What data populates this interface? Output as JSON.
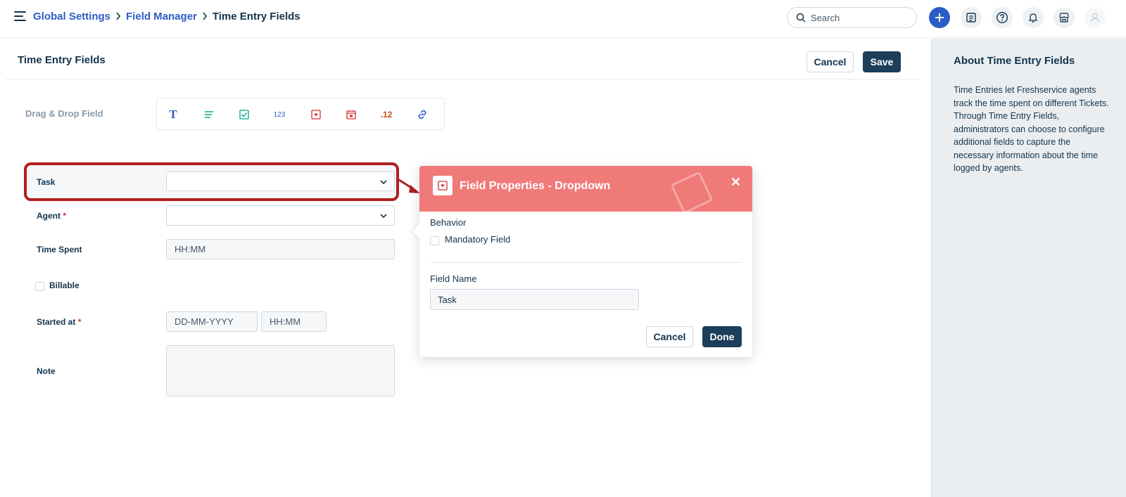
{
  "breadcrumb": {
    "items": [
      "Global Settings",
      "Field Manager"
    ],
    "current": "Time Entry Fields"
  },
  "search": {
    "placeholder": "Search"
  },
  "topbar_icons": [
    "plus-icon",
    "catalog-icon",
    "help-icon",
    "bell-icon",
    "store-icon",
    "user-avatar-icon"
  ],
  "page": {
    "title": "Time Entry Fields",
    "cancel_label": "Cancel",
    "save_label": "Save"
  },
  "palette": {
    "label": "Drag & Drop Field",
    "items": [
      {
        "icon": "text-field-icon",
        "glyph": "T",
        "color": "#2c5cc5"
      },
      {
        "icon": "paragraph-field-icon",
        "glyph": "",
        "color": "#00a886"
      },
      {
        "icon": "checkbox-field-icon",
        "glyph": "",
        "color": "#00a886"
      },
      {
        "icon": "number-field-icon",
        "glyph": "123",
        "color": "#2c5cc5"
      },
      {
        "icon": "dropdown-field-icon",
        "glyph": "",
        "color": "#d72d30"
      },
      {
        "icon": "date-field-icon",
        "glyph": "",
        "color": "#d72d30"
      },
      {
        "icon": "decimal-field-icon",
        "glyph": ".12",
        "color": "#c9500b"
      },
      {
        "icon": "url-field-icon",
        "glyph": "",
        "color": "#2c5cc5"
      }
    ]
  },
  "form": {
    "task_label": "Task",
    "agent_label": "Agent",
    "required_mark": "*",
    "time_spent_label": "Time Spent",
    "time_spent_placeholder": "HH:MM",
    "billable_label": "Billable",
    "started_at_label": "Started at",
    "date_placeholder": "DD-MM-YYYY",
    "time_placeholder": "HH:MM",
    "note_label": "Note"
  },
  "popover": {
    "title": "Field Properties - Dropdown",
    "behavior_label": "Behavior",
    "mandatory_label": "Mandatory Field",
    "field_name_label": "Field Name",
    "field_name_value": "Task",
    "cancel_label": "Cancel",
    "done_label": "Done",
    "header_color": "#f07a78"
  },
  "about": {
    "title": "About Time Entry Fields",
    "body": "Time Entries let Freshservice agents track the time spent on different Tickets. Through Time Entry Fields, administrators can choose to configure additional fields to capture the necessary information about the time logged by agents."
  },
  "colors": {
    "accent": "#2c5cc5",
    "primary_button": "#1d3e5a",
    "highlight": "#b01f1f"
  }
}
